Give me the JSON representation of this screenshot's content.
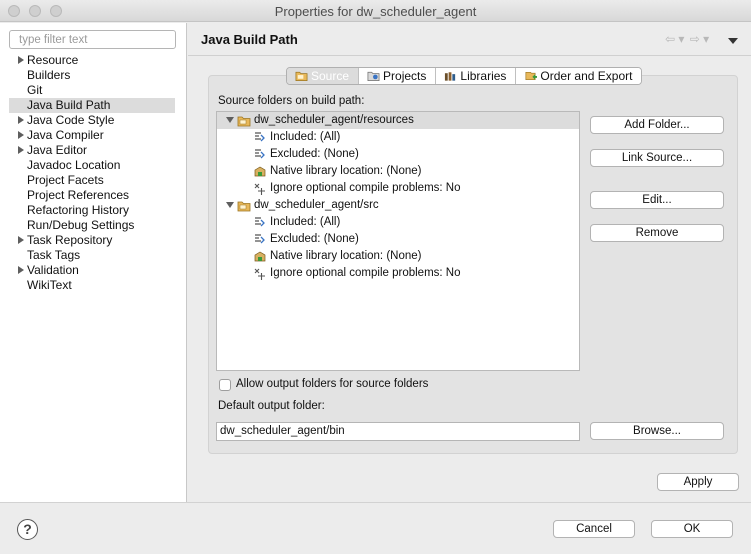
{
  "window": {
    "title": "Properties for dw_scheduler_agent"
  },
  "filter": {
    "placeholder": "type filter text",
    "value": ""
  },
  "nav": {
    "items": [
      {
        "label": "Resource",
        "expandable": true,
        "selected": false
      },
      {
        "label": "Builders",
        "expandable": false,
        "selected": false
      },
      {
        "label": "Git",
        "expandable": false,
        "selected": false
      },
      {
        "label": "Java Build Path",
        "expandable": false,
        "selected": true
      },
      {
        "label": "Java Code Style",
        "expandable": true,
        "selected": false
      },
      {
        "label": "Java Compiler",
        "expandable": true,
        "selected": false
      },
      {
        "label": "Java Editor",
        "expandable": true,
        "selected": false
      },
      {
        "label": "Javadoc Location",
        "expandable": false,
        "selected": false
      },
      {
        "label": "Project Facets",
        "expandable": false,
        "selected": false
      },
      {
        "label": "Project References",
        "expandable": false,
        "selected": false
      },
      {
        "label": "Refactoring History",
        "expandable": false,
        "selected": false
      },
      {
        "label": "Run/Debug Settings",
        "expandable": false,
        "selected": false
      },
      {
        "label": "Task Repository",
        "expandable": true,
        "selected": false
      },
      {
        "label": "Task Tags",
        "expandable": false,
        "selected": false
      },
      {
        "label": "Validation",
        "expandable": true,
        "selected": false
      },
      {
        "label": "WikiText",
        "expandable": false,
        "selected": false
      }
    ]
  },
  "page": {
    "title": "Java Build Path"
  },
  "tabs": [
    {
      "label": "Source",
      "icon": "source-folder-icon",
      "active": true
    },
    {
      "label": "Projects",
      "icon": "projects-icon",
      "active": false
    },
    {
      "label": "Libraries",
      "icon": "libraries-icon",
      "active": false
    },
    {
      "label": "Order and Export",
      "icon": "order-export-icon",
      "active": false
    }
  ],
  "source": {
    "heading": "Source folders on build path:",
    "folders": [
      {
        "name": "dw_scheduler_agent/resources",
        "children": [
          "Included: (All)",
          "Excluded: (None)",
          "Native library location: (None)",
          "Ignore optional compile problems: No"
        ]
      },
      {
        "name": "dw_scheduler_agent/src",
        "children": [
          "Included: (All)",
          "Excluded: (None)",
          "Native library location: (None)",
          "Ignore optional compile problems: No"
        ]
      }
    ],
    "buttons": {
      "add_folder": "Add Folder...",
      "link_source": "Link Source...",
      "edit": "Edit...",
      "remove": "Remove",
      "browse": "Browse..."
    },
    "allow_output_label": "Allow output folders for source folders",
    "allow_output_checked": false,
    "default_output_label": "Default output folder:",
    "default_output_value": "dw_scheduler_agent/bin"
  },
  "footer": {
    "apply": "Apply",
    "cancel": "Cancel",
    "ok": "OK",
    "help_symbol": "?"
  },
  "colors": {
    "selection": "#dcdcdc",
    "group_background": "#e3e3e3",
    "window_background": "#ececec"
  }
}
